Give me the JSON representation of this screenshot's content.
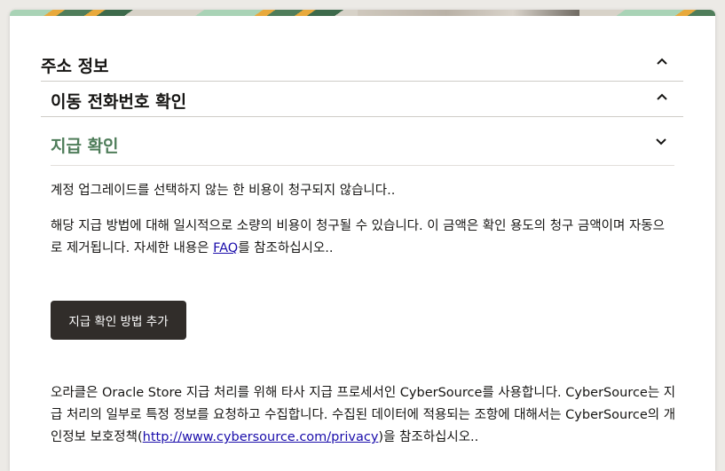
{
  "sections": [
    {
      "title": "주소 정보",
      "chevron": "chevron-up-icon"
    },
    {
      "title": "이동 전화번호 확인",
      "chevron": "chevron-up-icon"
    },
    {
      "title": "지급 확인",
      "chevron": "chevron-down-icon"
    }
  ],
  "payment": {
    "notice": "계정 업그레이드를 선택하지 않는 한 비용이 청구되지 않습니다..",
    "info_before": "해당 지급 방법에 대해 일시적으로 소량의 비용이 청구될 수 있습니다. 이 금액은 확인 용도의 청구 금액이며 자동으로 제거됩니다. 자세한 내용은 ",
    "faq_link": "FAQ",
    "info_after": "를 참조하십시오..",
    "add_button": "지급 확인 방법 추가",
    "cs_before": "오라클은 Oracle Store 지급 처리를 위해 타사 지급 프로세서인 CyberSource를 사용합니다. CyberSource는 지급 처리의 일부로 특정 정보를 요청하고 수집합니다. 수집된 데이터에 적용되는 조항에 대해서는 CyberSource의 개인정보 보호정책(",
    "cs_link": "http://www.cybersource.com/privacy",
    "cs_after": ")을 참조하십시오.."
  },
  "colors": {
    "accent": "#4f7d5a",
    "button": "#312d2a",
    "link": "#1a0dab"
  }
}
